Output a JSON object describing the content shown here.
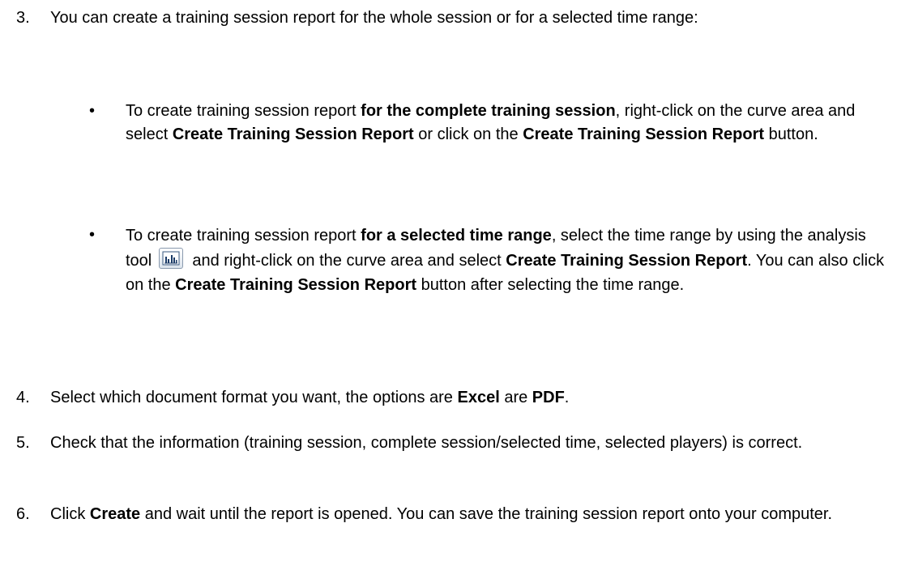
{
  "step3": {
    "number": "3.",
    "text": "You can create a training session report for the whole session or for a selected time range:",
    "bullet1": {
      "a": "To create training session report ",
      "b": "for the complete training session",
      "c": ", right-click on the curve area and select ",
      "d": "Create Training Session Report",
      "e": " or click on the ",
      "f": "Create Training Session Report",
      "g": " button."
    },
    "bullet2": {
      "a": "To create training session report ",
      "b": "for a selected time range",
      "c": ", select the time range by using the analysis tool ",
      "icon": "analysis-tool-icon",
      "d": " and right-click on the curve area and select ",
      "e": "Create Training Session Report",
      "f": ". You can also click on the ",
      "g": "Create Training Session Report",
      "h": " button after selecting the time range."
    }
  },
  "step4": {
    "number": "4.",
    "a": "Select which document format you want, the options are ",
    "b": "Excel",
    "c": " are ",
    "d": "PDF",
    "e": "."
  },
  "step5": {
    "number": "5.",
    "text": "Check that the information (training session, complete session/selected time, selected players) is correct."
  },
  "step6": {
    "number": "6.",
    "a": "Click ",
    "b": "Create",
    "c": " and wait until the report is opened. You can save the training session report onto your computer."
  },
  "bullet_glyph": "•"
}
